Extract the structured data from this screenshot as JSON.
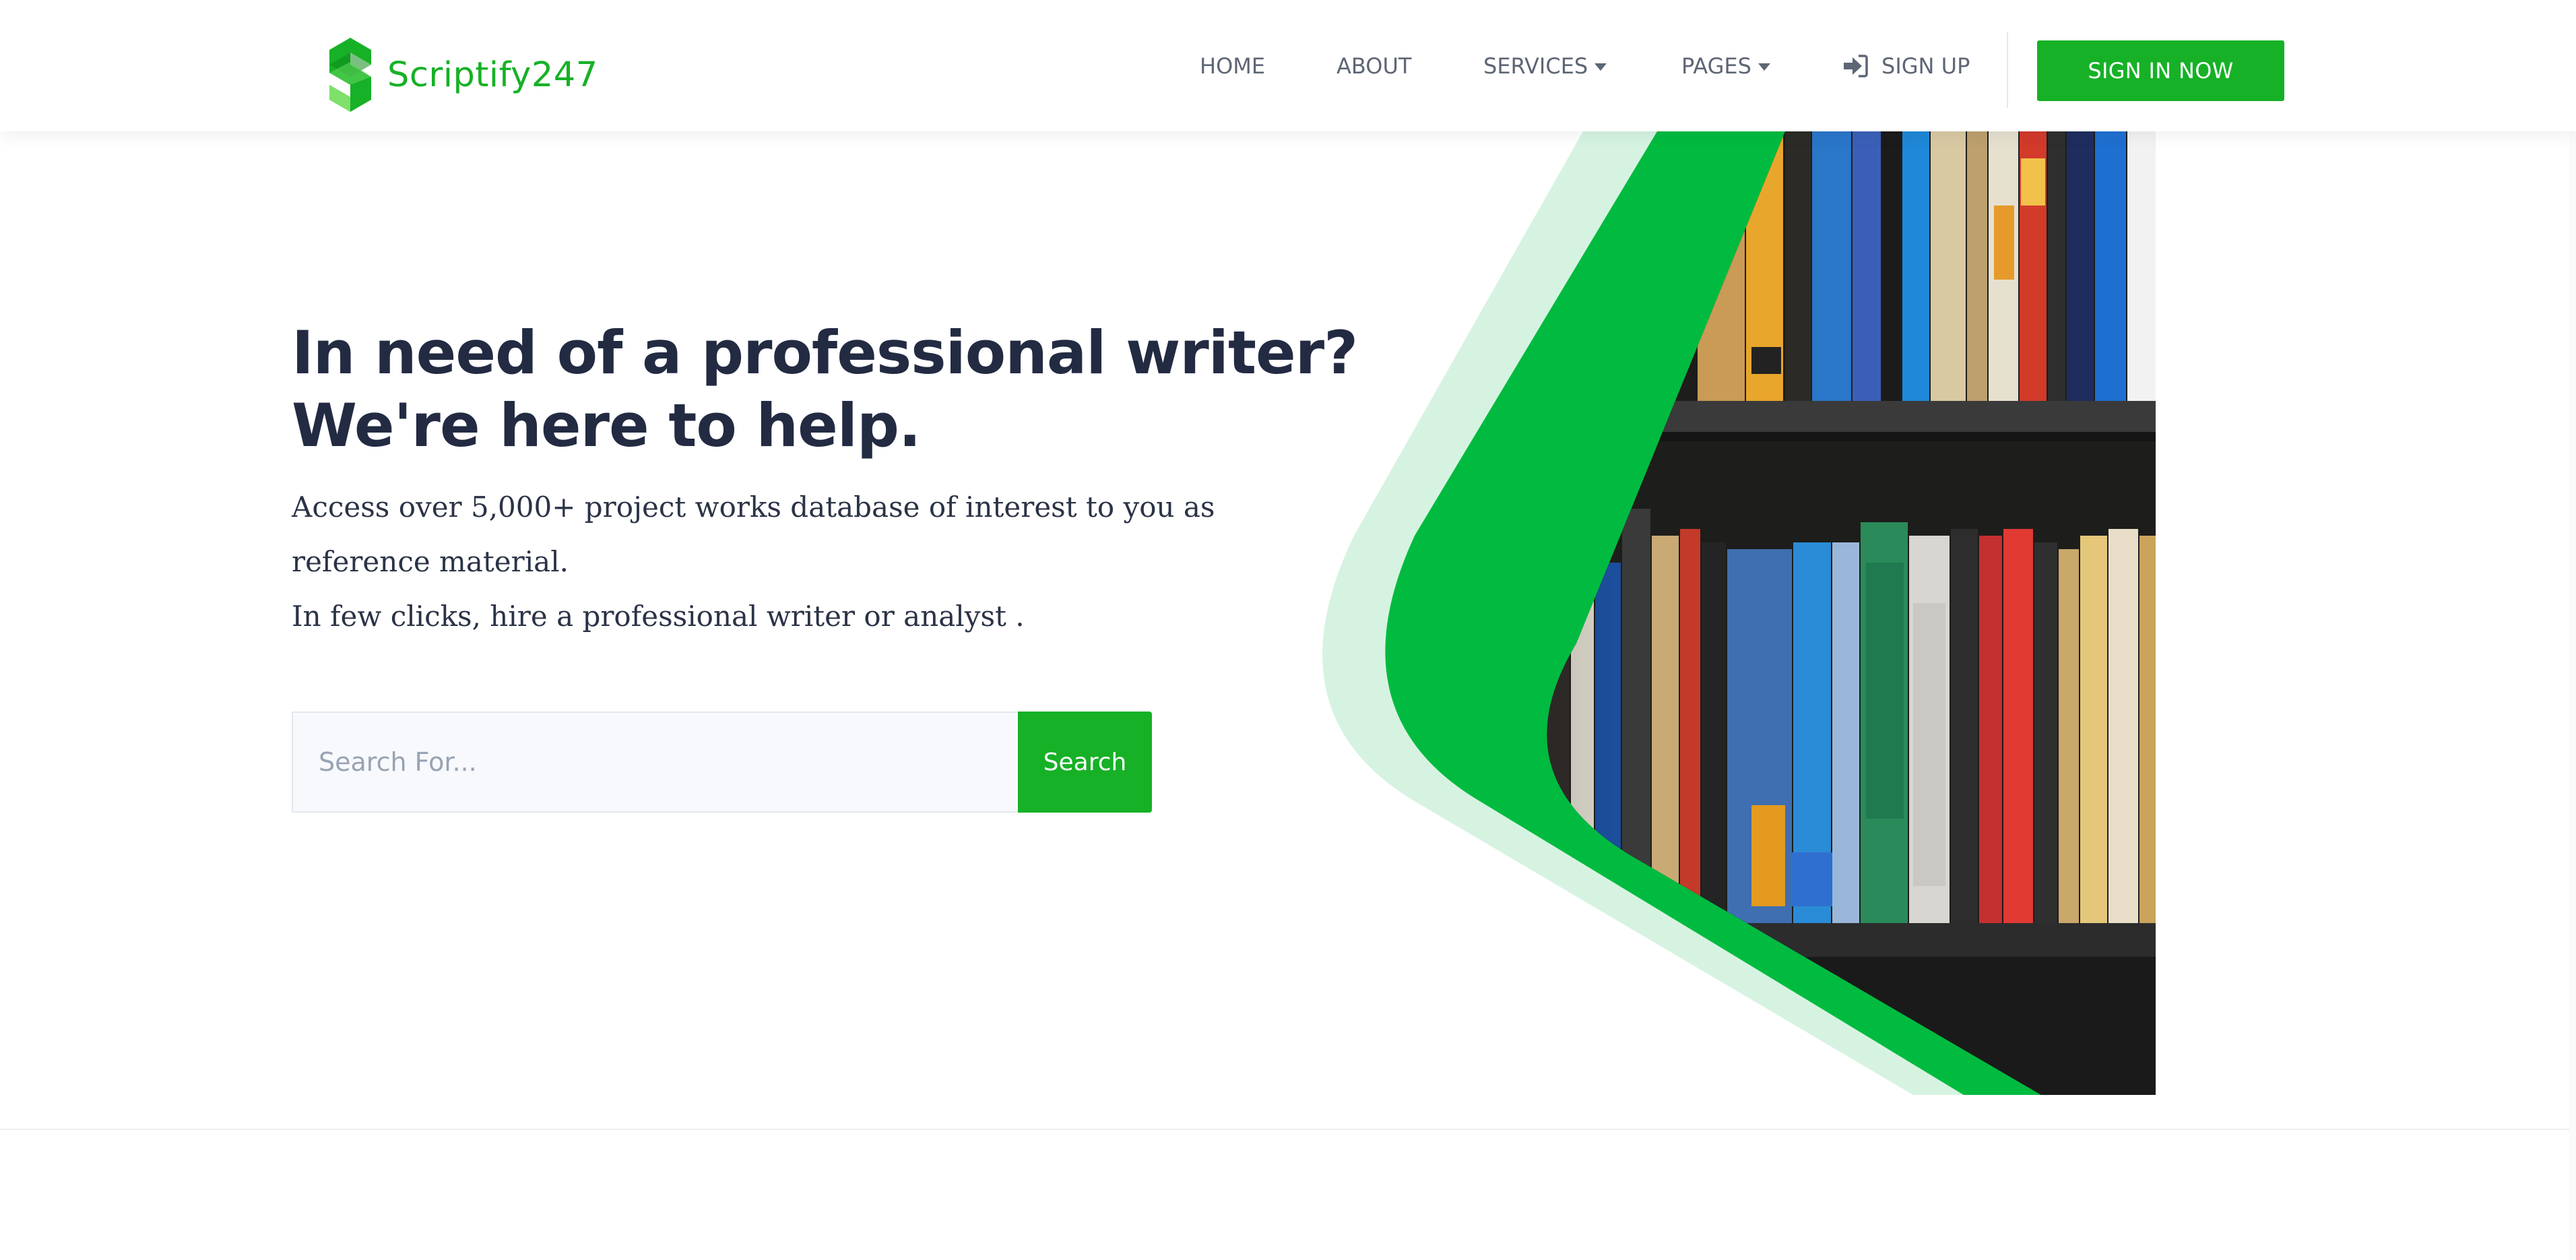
{
  "brand": {
    "name": "Scriptify247",
    "icon": "s-logo-icon",
    "color": "#16b126"
  },
  "nav": {
    "home": "HOME",
    "about": "ABOUT",
    "services": "SERVICES",
    "pages": "PAGES",
    "signup": "SIGN UP",
    "signup_icon": "sign-in-icon",
    "cta": "SIGN IN NOW"
  },
  "hero": {
    "title_line1": "In need of a professional writer?",
    "title_line2": "We're here to help.",
    "text_line1": "Access over 5,000+ project works database of interest to you as",
    "text_line2": "reference material.",
    "text_line3": "In few clicks, hire a professional writer or analyst .",
    "image": "bookshelf-photo"
  },
  "search": {
    "placeholder": "Search For...",
    "value": "",
    "button": "Search"
  },
  "colors": {
    "accent": "#16b126",
    "accent_light": "#d6f3e1",
    "heading": "#232b43",
    "nav_text": "#5d6675"
  }
}
